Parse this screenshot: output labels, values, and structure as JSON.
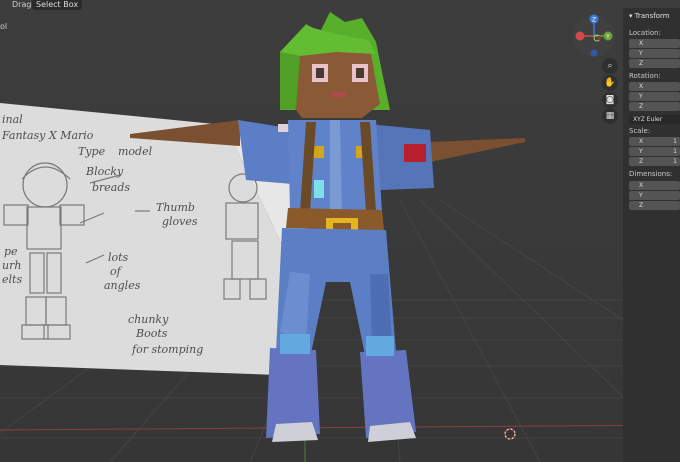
{
  "header": {
    "drag_label": "Drag:",
    "drag_value": "Select Box",
    "left_text": "ol"
  },
  "gizmo": {
    "z": "Z",
    "y": "Y",
    "x": "X"
  },
  "n_panel": {
    "tab_label": "Transform",
    "location_label": "Location:",
    "rotation_label": "Rotation:",
    "rotation_mode": "XYZ Euler",
    "scale_label": "Scale:",
    "dimensions_label": "Dimensions:",
    "axes": [
      "X",
      "Y",
      "Z"
    ],
    "scale_values": [
      "1",
      "1",
      "1"
    ]
  },
  "reference_sheet": {
    "lines": [
      "inal",
      "Fantasy X Mario",
      "Type",
      "model",
      "Blocky",
      "breads",
      "Thumb",
      "gloves",
      "lots",
      "of",
      "angles",
      "chunky",
      "Boots",
      "for stomping",
      "pe",
      "urh",
      "elts"
    ]
  },
  "colors": {
    "viewport_bg": "#3a3a3a",
    "panel_bg": "#303030",
    "hair": "#5cb52c",
    "skin": "#8a5a36",
    "outfit": "#5b7ec4",
    "belt": "#8a5a2a",
    "buckle": "#e2b521",
    "axis_red": "#d24a4a",
    "axis_green": "#6aa131",
    "axis_blue": "#3d78d8"
  }
}
